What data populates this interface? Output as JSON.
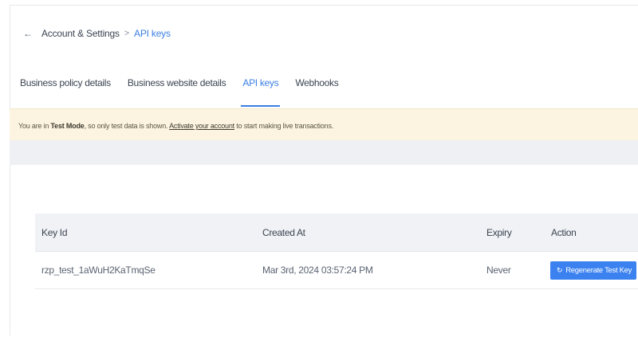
{
  "breadcrumb": {
    "back_icon": "arrow-left-icon",
    "parent": "Account & Settings",
    "separator": ">",
    "current": "API keys"
  },
  "tabs": [
    {
      "label": "Business policy details",
      "active": false
    },
    {
      "label": "Business website details",
      "active": false
    },
    {
      "label": "API keys",
      "active": true
    },
    {
      "label": "Webhooks",
      "active": false
    }
  ],
  "banner": {
    "prefix": "You are in ",
    "mode": "Test Mode",
    "middle": ", so only test data is shown. ",
    "link": "Activate your account",
    "suffix": " to start making live transactions."
  },
  "table": {
    "headers": [
      "Key Id",
      "Created At",
      "Expiry",
      "Action"
    ],
    "rows": [
      {
        "key_id": "rzp_test_1aWuH2KaTmqSe",
        "created_at": "Mar 3rd, 2024 03:57:24 PM",
        "expiry": "Never",
        "action_label": "Regenerate Test Key",
        "action_icon": "refresh-icon"
      }
    ]
  },
  "colors": {
    "accent": "#3b7fe3",
    "button": "#3b82f0",
    "banner_bg": "#fcf4e0",
    "header_bg": "#f0f2f5"
  }
}
